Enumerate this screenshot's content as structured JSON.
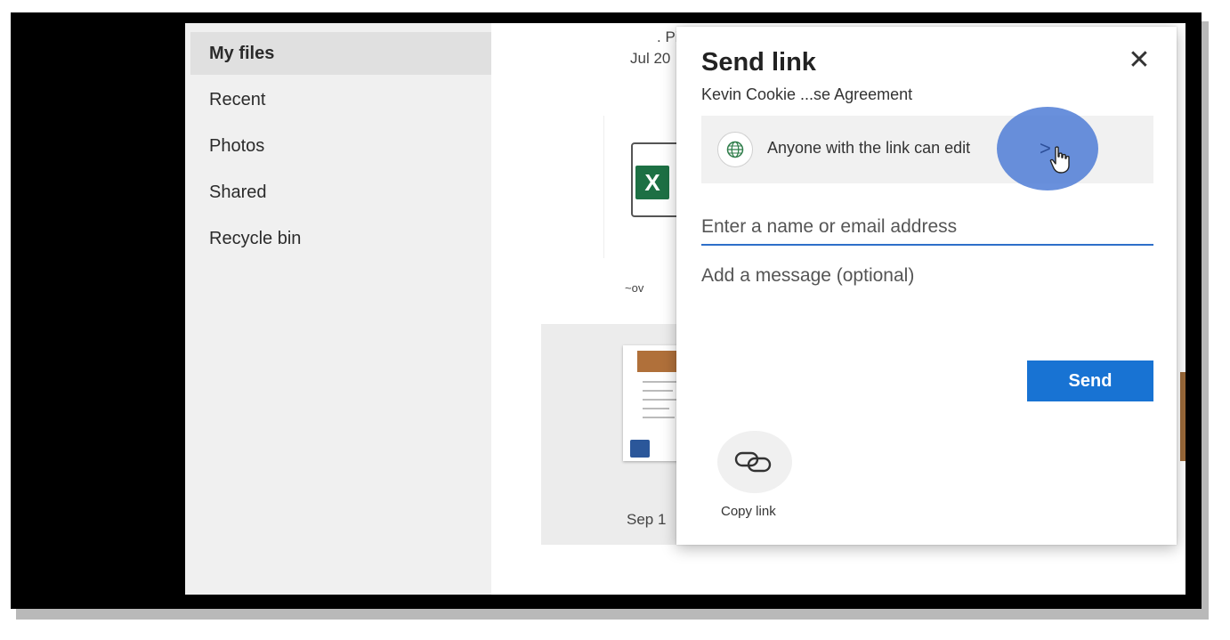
{
  "sidebar": {
    "items": [
      {
        "label": "My files",
        "active": true
      },
      {
        "label": "Recent"
      },
      {
        "label": "Photos"
      },
      {
        "label": "Shared"
      },
      {
        "label": "Recycle bin"
      }
    ]
  },
  "background_files": {
    "tile1_name_fragment": ". Pi",
    "tile1_date_fragment": "Jul 20",
    "tile1_badge": "X",
    "tile1_side_fragment": "~ov",
    "tile2_date_fragment": "Sep 1"
  },
  "dialog": {
    "title": "Send link",
    "subtitle": "Kevin Cookie ...se Agreement",
    "close_glyph": "✕",
    "permission_text": "Anyone with the link can edit",
    "chevron_glyph": ">",
    "recipient_placeholder": "Enter a name or email address",
    "message_placeholder": "Add a message (optional)",
    "send_label": "Send",
    "copy_link_label": "Copy link"
  },
  "colors": {
    "accent": "#1873d3",
    "excel_green": "#1d7044",
    "word_blue": "#2b579a",
    "highlight": "#4878d4"
  }
}
